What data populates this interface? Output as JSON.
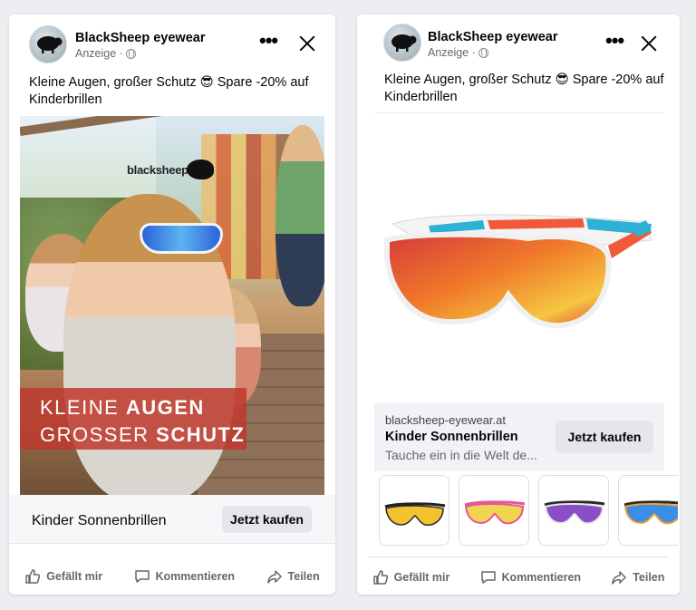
{
  "ads": [
    {
      "advertiser": "BlackSheep eyewear",
      "sponsored": "Anzeige ·",
      "text": "Kleine Augen, großer Schutz 😎 Spare -20% auf Kinderbrillen",
      "image_logo": "blacksheep",
      "headline_line1_a": "KLEINE ",
      "headline_line1_b": "AUGEN",
      "headline_line2_a": "GROSSER ",
      "headline_line2_b": "SCHUTZ",
      "cta_title": "Kinder Sonnenbrillen",
      "cta_button": "Jetzt kaufen"
    },
    {
      "advertiser": "BlackSheep eyewear",
      "sponsored": "Anzeige ·",
      "text": "Kleine Augen, großer Schutz 😎 Spare -20% auf Kinderbrillen",
      "domain": "blacksheep-eyewear.at",
      "link_title": "Kinder Sonnenbrillen",
      "link_desc": "Tauche ein in die Welt de...",
      "cta_button": "Jetzt kaufen",
      "thumbnails": [
        "sunglasses-yellow",
        "sunglasses-pink",
        "sunglasses-purple",
        "sunglasses-blue"
      ]
    }
  ],
  "actions": {
    "like": "Gefällt mir",
    "comment": "Kommentieren",
    "share": "Teilen"
  },
  "colors": {
    "banner": "#be3a2d",
    "button_bg": "#e4e6eb",
    "secondary_text": "#65676b"
  }
}
